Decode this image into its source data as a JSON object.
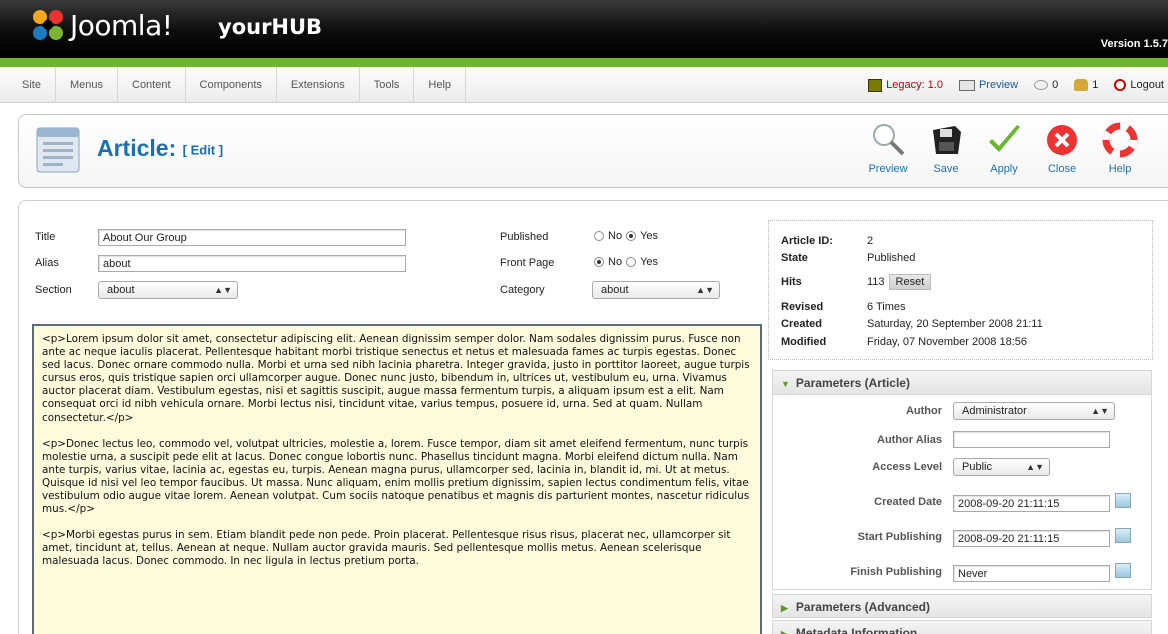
{
  "header": {
    "brand": "Joomla!",
    "site_name": "yourHUB",
    "version": "Version 1.5.7"
  },
  "menu": [
    "Site",
    "Menus",
    "Content",
    "Components",
    "Extensions",
    "Tools",
    "Help"
  ],
  "status": {
    "legacy": "Legacy: 1.0",
    "preview": "Preview",
    "messages": "0",
    "users": "1",
    "logout": "Logout"
  },
  "toolbar": {
    "title": "Article:",
    "subtitle": "[ Edit ]",
    "buttons": [
      "Preview",
      "Save",
      "Apply",
      "Close",
      "Help"
    ]
  },
  "form": {
    "title_label": "Title",
    "title_value": "About Our Group",
    "alias_label": "Alias",
    "alias_value": "about",
    "section_label": "Section",
    "section_value": "about",
    "published_label": "Published",
    "frontpage_label": "Front Page",
    "category_label": "Category",
    "category_value": "about",
    "no": "No",
    "yes": "Yes"
  },
  "editor": {
    "paragraphs": [
      "<p>Lorem ipsum dolor sit amet, consectetur adipiscing elit. Aenean dignissim semper dolor. Nam sodales dignissim purus. Fusce non ante ac neque iaculis placerat. Pellentesque habitant morbi tristique senectus et netus et malesuada fames ac turpis egestas. Donec sed lacus. Donec ornare commodo nulla. Morbi et urna sed nibh lacinia pharetra. Integer gravida, justo in porttitor laoreet, augue turpis cursus eros, quis tristique sapien orci ullamcorper augue. Donec nunc justo, bibendum in, ultrices ut, vestibulum eu, urna. Vivamus auctor placerat diam. Vestibulum egestas, nisi et sagittis suscipit, augue massa fermentum turpis, a aliquam ipsum est a elit. Nam consequat orci id nibh vehicula ornare. Morbi lectus nisi, tincidunt vitae, varius tempus, posuere id, urna. Sed at quam. Nullam consectetur.</p>",
      "<p>Donec lectus leo, commodo vel, volutpat ultricies, molestie a, lorem. Fusce tempor, diam sit amet eleifend fermentum, nunc turpis molestie urna, a suscipit pede elit at lacus. Donec congue lobortis nunc. Phasellus tincidunt magna. Morbi eleifend dictum nulla. Nam ante turpis, varius vitae, lacinia ac, egestas eu, turpis. Aenean magna purus, ullamcorper sed, lacinia in, blandit id, mi. Ut at metus. Quisque id nisi vel leo tempor faucibus. Ut massa. Nunc aliquam, enim mollis pretium dignissim, sapien lectus condimentum felis, vitae vestibulum odio augue vitae lorem. Aenean volutpat. Cum sociis natoque penatibus et magnis dis parturient montes, nascetur ridiculus mus.</p>",
      "<p>Morbi egestas purus in sem. Etiam blandit pede non pede. Proin placerat. Pellentesque risus risus, placerat nec, ullamcorper sit amet, tincidunt at, tellus. Aenean at neque. Nullam auctor gravida mauris. Sed pellentesque mollis metus. Aenean scelerisque malesuada lacus. Donec commodo. In nec ligula in lectus pretium porta."
    ]
  },
  "info": {
    "article_id_label": "Article ID:",
    "article_id": "2",
    "state_label": "State",
    "state": "Published",
    "hits_label": "Hits",
    "hits": "113",
    "reset": "Reset",
    "revised_label": "Revised",
    "revised": "6 Times",
    "created_label": "Created",
    "created": "Saturday, 20 September 2008 21:11",
    "modified_label": "Modified",
    "modified": "Friday, 07 November 2008 18:56"
  },
  "params": {
    "title": "Parameters (Article)",
    "author_label": "Author",
    "author": "Administrator",
    "alias_label": "Author Alias",
    "alias": "",
    "access_label": "Access Level",
    "access": "Public",
    "created_label": "Created Date",
    "created": "2008-09-20 21:11:15",
    "start_label": "Start Publishing",
    "start": "2008-09-20 21:11:15",
    "finish_label": "Finish Publishing",
    "finish": "Never"
  },
  "sections": {
    "advanced": "Parameters (Advanced)",
    "metadata": "Metadata Information"
  },
  "colors": {
    "accent": "#1a6fb3",
    "green_bar": "#6fb52c",
    "editor_bg": "#fdfbdc"
  }
}
